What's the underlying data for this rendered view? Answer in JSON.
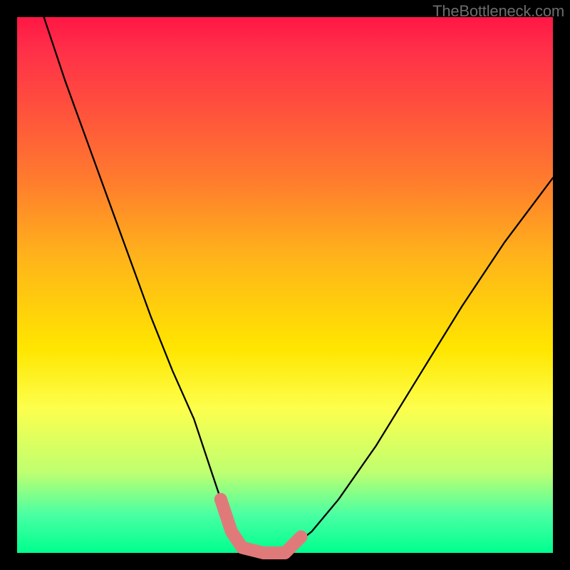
{
  "watermark": "TheBottleneck.com",
  "chart_data": {
    "type": "line",
    "title": "",
    "xlabel": "",
    "ylabel": "",
    "xlim": [
      0,
      100
    ],
    "ylim": [
      0,
      100
    ],
    "series": [
      {
        "name": "bottleneck-curve",
        "x": [
          5,
          9,
          13,
          17,
          21,
          25,
          29,
          33,
          36,
          38,
          40,
          42,
          46,
          50,
          55,
          60,
          67,
          75,
          83,
          91,
          100
        ],
        "values": [
          100,
          88,
          77,
          66,
          55,
          44,
          34,
          25,
          16,
          10,
          5,
          2,
          0,
          0,
          4,
          10,
          20,
          33,
          46,
          58,
          70
        ]
      },
      {
        "name": "highlight-band",
        "x": [
          38,
          40,
          42,
          46,
          50,
          53
        ],
        "values": [
          10,
          4,
          1,
          0,
          0,
          3
        ]
      }
    ],
    "gradient_stops": [
      {
        "pos": 0.0,
        "color": "#ff1744"
      },
      {
        "pos": 0.3,
        "color": "#ff7a2e"
      },
      {
        "pos": 0.62,
        "color": "#ffe600"
      },
      {
        "pos": 0.85,
        "color": "#beff70"
      },
      {
        "pos": 1.0,
        "color": "#00ff8f"
      }
    ],
    "highlight_color": "#e07a7a"
  }
}
